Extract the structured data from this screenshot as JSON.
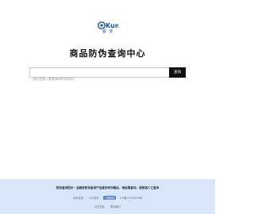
{
  "brand": {
    "logo_text": "Kun",
    "logo_sub": "鲲 溥"
  },
  "title": "商品防伪查询中心",
  "search": {
    "placeholder": "请在此输入需要查询的防伪码",
    "value": "",
    "button_label": "查询"
  },
  "footer": {
    "tip": "防伪查询提示：当确定防伪查询产品真伪有问题后，请后期查询，请拨通人工查询",
    "tech_support_label": "技术支持：",
    "tech_support_value": "CSS技术",
    "badge": "中国网络",
    "icp": "ICP备12345678号",
    "links": [
      "官方网站",
      "联系我们"
    ]
  },
  "colors": {
    "accent": "#111111",
    "footer_bg": "#d9e6fa",
    "logo_blue": "#1a4ea8"
  }
}
